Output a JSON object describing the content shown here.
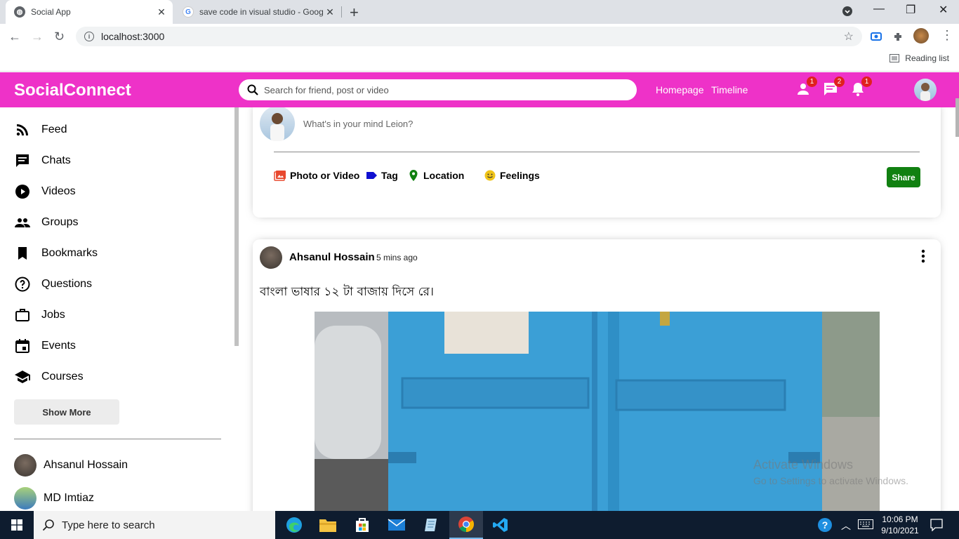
{
  "browser": {
    "tabs": [
      {
        "title": "Social App",
        "active": true
      },
      {
        "title": "save code in visual studio - Goog",
        "active": false
      }
    ],
    "url": "localhost:3000",
    "reading_list": "Reading list"
  },
  "app": {
    "logo": "SocialConnect",
    "search_placeholder": "Search for friend, post or video",
    "nav_links": [
      "Homepage",
      "Timeline"
    ],
    "badges": {
      "friends": "1",
      "chats": "2",
      "notifications": "1"
    },
    "accent": "#ee32c8"
  },
  "sidebar": {
    "items": [
      {
        "label": "Feed",
        "icon": "rss-feed-icon"
      },
      {
        "label": "Chats",
        "icon": "chat-icon"
      },
      {
        "label": "Videos",
        "icon": "play-circle-icon"
      },
      {
        "label": "Groups",
        "icon": "group-icon"
      },
      {
        "label": "Bookmarks",
        "icon": "bookmark-icon"
      },
      {
        "label": "Questions",
        "icon": "help-circle-icon"
      },
      {
        "label": "Jobs",
        "icon": "briefcase-icon"
      },
      {
        "label": "Events",
        "icon": "calendar-icon"
      },
      {
        "label": "Courses",
        "icon": "school-icon"
      }
    ],
    "show_more": "Show More",
    "friends": [
      {
        "name": "Ahsanul Hossain"
      },
      {
        "name": "MD Imtiaz"
      }
    ]
  },
  "share": {
    "placeholder": "What's in your mind Leion?",
    "options": [
      "Photo or Video",
      "Tag",
      "Location",
      "Feelings"
    ],
    "button": "Share"
  },
  "post": {
    "author": "Ahsanul Hossain",
    "time": "5 mins ago",
    "text": "বাংলা ভাষার ১২ টা বাজায় দিসে রে।"
  },
  "overlay": {
    "watermark_title": "Activate Windows",
    "watermark_sub": "Go to Settings to activate Windows."
  },
  "taskbar": {
    "search_placeholder": "Type here to search",
    "time": "10:06 PM",
    "date": "9/10/2021"
  }
}
